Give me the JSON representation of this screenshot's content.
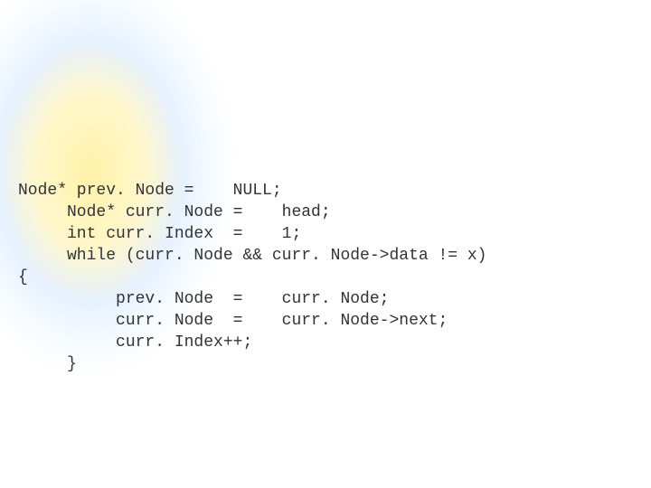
{
  "code": {
    "lines": [
      "Node* prev. Node =    NULL;",
      "     Node* curr. Node =    head;",
      "     int curr. Index  =    1;",
      "     while (curr. Node && curr. Node->data != x)",
      "{",
      "          prev. Node  =    curr. Node;",
      "          curr. Node  =    curr. Node->next;",
      "          curr. Index++;",
      "     }"
    ]
  }
}
